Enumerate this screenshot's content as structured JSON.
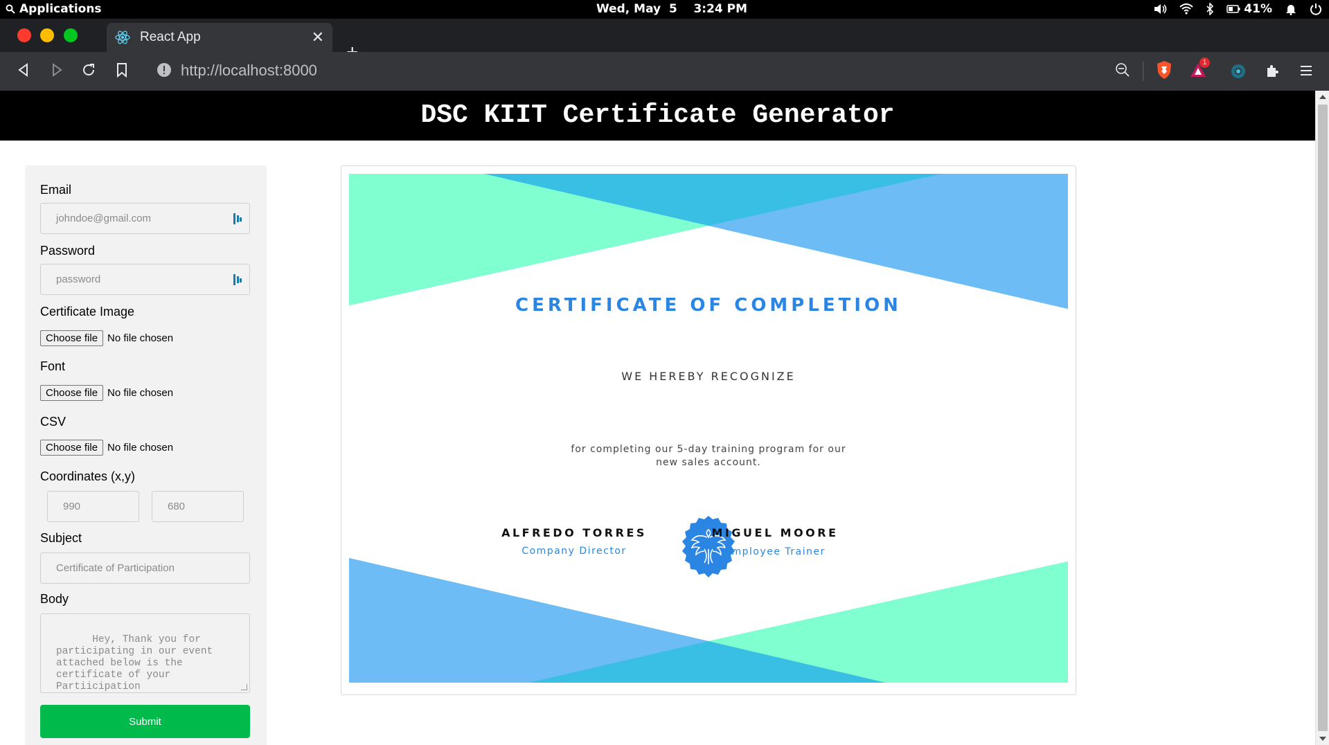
{
  "os": {
    "menu_label": "Applications",
    "clock": "Wed, May  5    3:24 PM",
    "battery": "41%"
  },
  "browser": {
    "tab_title": "React App",
    "close_glyph": "✕",
    "new_tab_glyph": "+",
    "url": "http://localhost:8000",
    "notification_badge": "1"
  },
  "app": {
    "title": "DSC KIIT Certificate Generator"
  },
  "form": {
    "email_label": "Email",
    "email_placeholder": "johndoe@gmail.com",
    "password_label": "Password",
    "password_placeholder": "password",
    "cert_image_label": "Certificate Image",
    "font_label": "Font",
    "csv_label": "CSV",
    "choose_file": "Choose file",
    "no_file": "No file chosen",
    "coords_label": "Coordinates (x,y)",
    "coord_x_placeholder": "990",
    "coord_y_placeholder": "680",
    "subject_label": "Subject",
    "subject_placeholder": "Certificate of Participation",
    "body_label": "Body",
    "body_placeholder": "Hey, Thank you for participating in our event attached below is the certificate of your Partiicipation",
    "submit_label": "Submit"
  },
  "certificate": {
    "title": "CERTIFICATE OF COMPLETION",
    "recognize": "WE HEREBY RECOGNIZE",
    "body": "for completing our 5-day training program for our new sales account.",
    "signer1_name": "ALFREDO TORRES",
    "signer1_role": "Company Director",
    "signer2_name": "MIGUEL MOORE",
    "signer2_role": "Employee Trainer",
    "colors": {
      "mint": "#80ffd0",
      "sky": "#6ebcf5",
      "cyan": "#39bfe3",
      "blue": "#2b86e3"
    }
  },
  "colors": {
    "submit": "#00bb4c",
    "header_bg": "#000000"
  }
}
